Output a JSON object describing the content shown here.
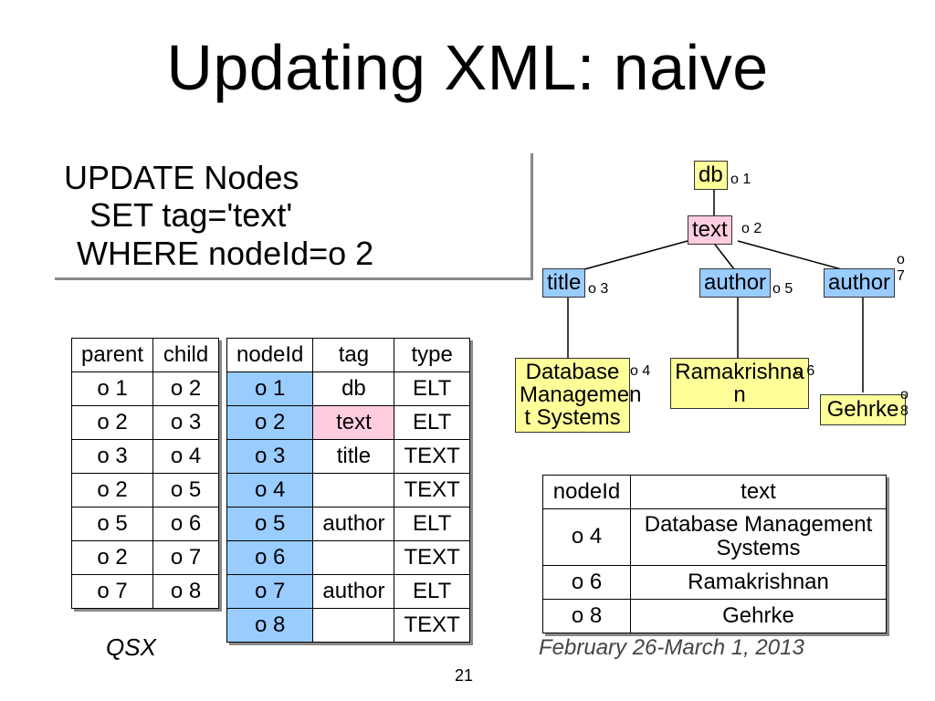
{
  "title": "Updating XML: naive",
  "sql": {
    "line1": "UPDATE Nodes",
    "line2": "SET tag='text'",
    "line3": "WHERE nodeId=o 2"
  },
  "edges": {
    "headers": [
      "parent",
      "child"
    ],
    "rows": [
      [
        "o 1",
        "o 2"
      ],
      [
        "o 2",
        "o 3"
      ],
      [
        "o 3",
        "o 4"
      ],
      [
        "o 2",
        "o 5"
      ],
      [
        "o 5",
        "o 6"
      ],
      [
        "o 2",
        "o 7"
      ],
      [
        "o 7",
        "o 8"
      ]
    ]
  },
  "nodes": {
    "headers": [
      "nodeId",
      "tag",
      "type"
    ],
    "rows": [
      [
        "o 1",
        "db",
        "ELT"
      ],
      [
        "o 2",
        "text",
        "ELT"
      ],
      [
        "o 3",
        "title",
        "TEXT"
      ],
      [
        "o 4",
        "",
        "TEXT"
      ],
      [
        "o 5",
        "author",
        "ELT"
      ],
      [
        "o 6",
        "",
        "TEXT"
      ],
      [
        "o 7",
        "author",
        "ELT"
      ],
      [
        "o 8",
        "",
        "TEXT"
      ]
    ]
  },
  "textTable": {
    "headers": [
      "nodeId",
      "text"
    ],
    "rows": [
      [
        "o 4",
        "Database Management Systems"
      ],
      [
        "o 6",
        "Ramakrishnan"
      ],
      [
        "o 8",
        "Gehrke"
      ]
    ]
  },
  "tree": {
    "db": {
      "label": "db",
      "id": "o 1"
    },
    "book": {
      "label": "text",
      "id": "o 2"
    },
    "title": {
      "label": "title",
      "id": "o 3"
    },
    "author1": {
      "label": "author",
      "id": "o 5"
    },
    "author2": {
      "label": "author",
      "id": "o 7"
    },
    "leaf4": {
      "line1": "Database",
      "line2": "Managemen",
      "line3": "t Systems",
      "id": "o 4"
    },
    "leaf6": {
      "line1": "Ramakrishna",
      "line2": "n",
      "id": "o 6"
    },
    "leaf8": {
      "text": "Gehrke",
      "id": "o 8"
    }
  },
  "footer": {
    "qsx": "QSX",
    "dateline": "February 26-March 1, 2013",
    "slidenum": "21"
  }
}
